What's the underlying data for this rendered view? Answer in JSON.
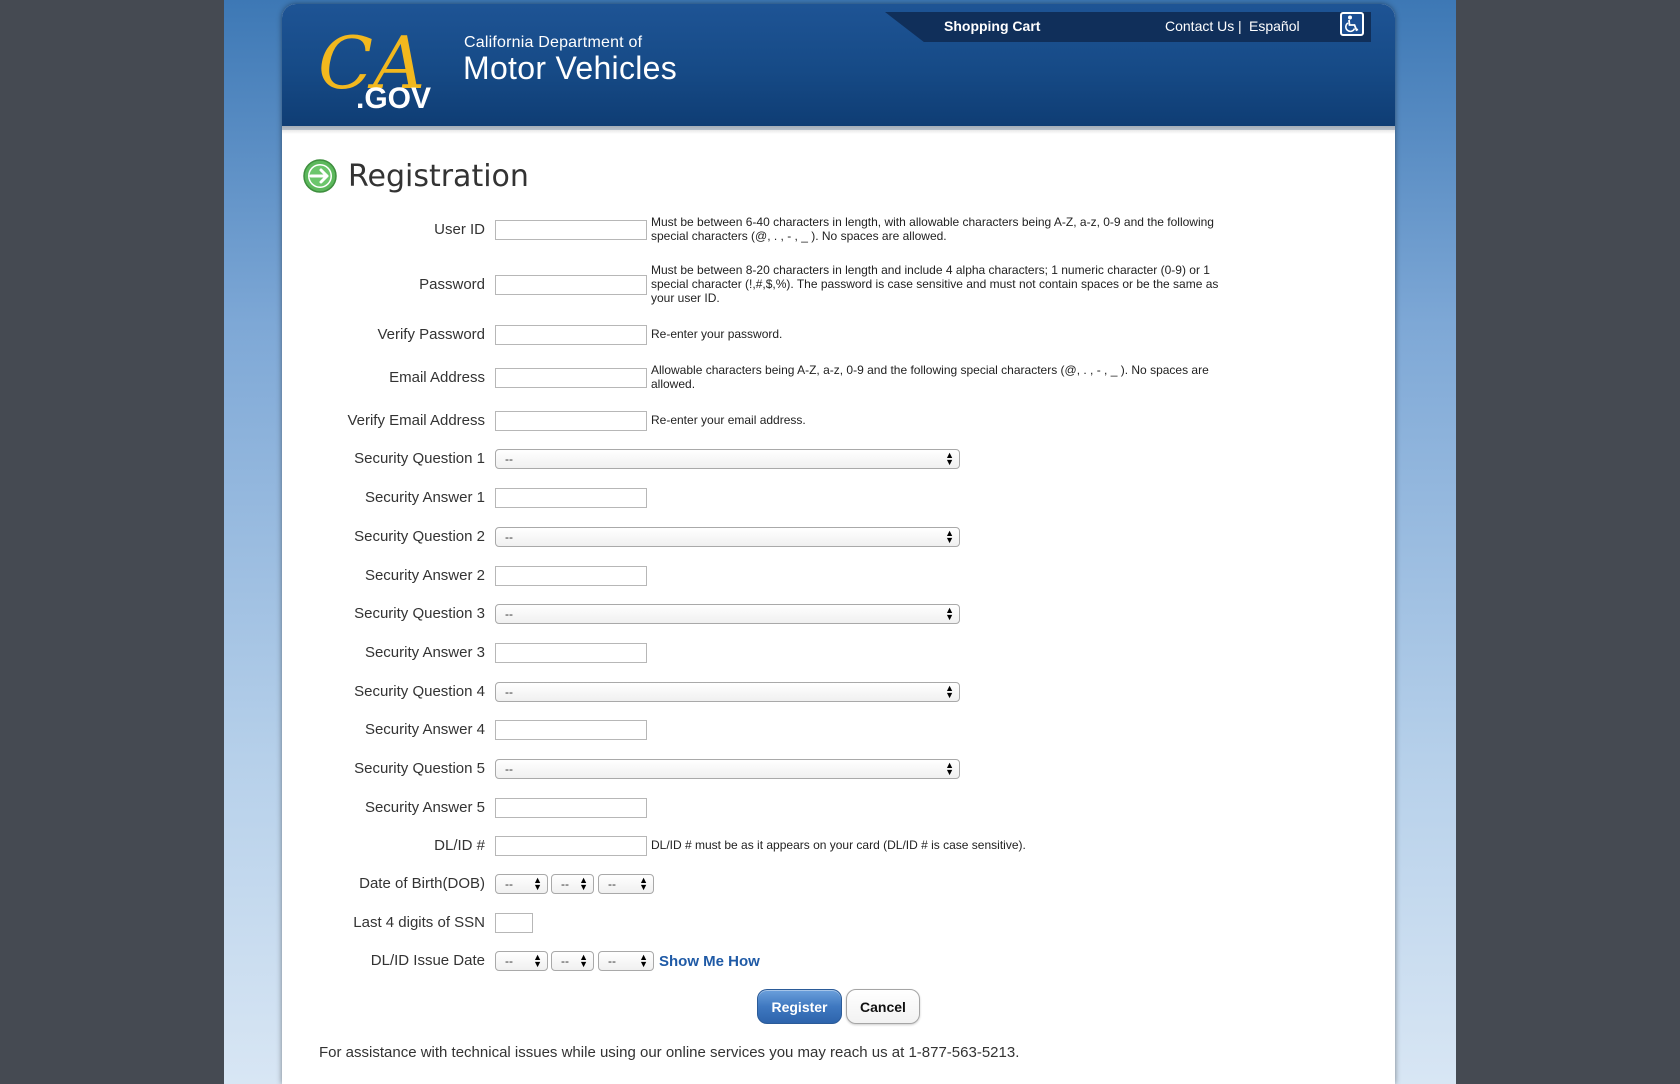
{
  "header": {
    "dept_line1": "California Department of",
    "dept_line2": "Motor Vehicles",
    "logo_text_ca": "CA",
    "logo_text_gov": ".GOV",
    "nav": {
      "shopping_cart": "Shopping Cart",
      "contact_us": "Contact Us",
      "separator": "|",
      "espanol": "Español"
    },
    "accessibility_icon": "wheelchair-icon"
  },
  "form": {
    "title": "Registration",
    "title_icon": "green-arrow-icon",
    "user_id": {
      "label": "User ID",
      "value": "",
      "hint": "Must be between 6-40 characters in length, with allowable characters being A-Z, a-z, 0-9 and the following special characters (@, . , - , _ ). No spaces are allowed."
    },
    "password": {
      "label": "Password",
      "value": "",
      "hint": "Must be between 8-20 characters in length and include 4 alpha characters; 1 numeric character (0-9) or 1 special character (!,#,$,%). The password is case sensitive and must not contain spaces or be the same as your user ID."
    },
    "verify_password": {
      "label": "Verify Password",
      "value": "",
      "hint": "Re-enter your password."
    },
    "email": {
      "label": "Email Address",
      "value": "",
      "hint": "Allowable characters being A-Z, a-z, 0-9 and the following special characters (@, . , - , _ ). No spaces are allowed."
    },
    "verify_email": {
      "label": "Verify Email Address",
      "value": "",
      "hint": "Re-enter your email address."
    },
    "security": [
      {
        "q_label": "Security Question 1",
        "q_value": "--",
        "a_label": "Security Answer 1",
        "a_value": ""
      },
      {
        "q_label": "Security Question 2",
        "q_value": "--",
        "a_label": "Security Answer 2",
        "a_value": ""
      },
      {
        "q_label": "Security Question 3",
        "q_value": "--",
        "a_label": "Security Answer 3",
        "a_value": ""
      },
      {
        "q_label": "Security Question 4",
        "q_value": "--",
        "a_label": "Security Answer 4",
        "a_value": ""
      },
      {
        "q_label": "Security Question 5",
        "q_value": "--",
        "a_label": "Security Answer 5",
        "a_value": ""
      }
    ],
    "dlid": {
      "label": "DL/ID #",
      "value": "",
      "hint": "DL/ID # must be as it appears on your card (DL/ID # is case sensitive)."
    },
    "dob": {
      "label": "Date of Birth(DOB)",
      "month": "--",
      "day": "--",
      "year": "--"
    },
    "ssn": {
      "label": "Last 4 digits of SSN",
      "value": ""
    },
    "issue_date": {
      "label": "DL/ID Issue Date",
      "month": "--",
      "day": "--",
      "year": "--",
      "help_link": "Show Me How"
    },
    "buttons": {
      "register": "Register",
      "cancel": "Cancel"
    },
    "assistance": "For assistance with technical issues while using our online services you may reach us at 1-877-563-5213."
  },
  "colors": {
    "header_blue": "#164a86",
    "link_blue": "#1f5aa6",
    "register_blue": "#3f78c0",
    "logo_gold": "#f2b81e"
  }
}
